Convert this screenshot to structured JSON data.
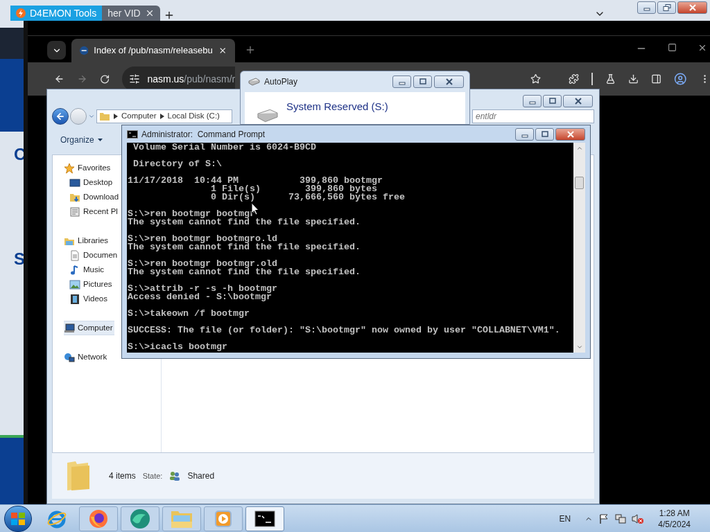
{
  "outer_browser": {
    "tabs": [
      {
        "title": "D4EMON Tools",
        "selected": true
      },
      {
        "title": "her VID",
        "selected": false
      }
    ],
    "page_fragments": [
      "C",
      "S"
    ]
  },
  "browser": {
    "tabs": [
      {
        "title": "Index of /pub/nasm/releasebu",
        "selected": true
      }
    ],
    "address": {
      "host": "nasm.us",
      "path": "/pub/nasm/r"
    }
  },
  "explorer": {
    "breadcrumb": [
      "Computer",
      "Local Disk (C:)"
    ],
    "search_placeholder": "entldr",
    "toolbar": [
      "Organize"
    ],
    "nav": [
      {
        "label": "Favorites",
        "kind": "favorites",
        "selected": false,
        "children": [
          {
            "label": "Desktop",
            "kind": "desktop",
            "selected": false
          },
          {
            "label": "Download",
            "kind": "downloads",
            "selected": false
          },
          {
            "label": "Recent Pl",
            "kind": "recent",
            "selected": false
          }
        ]
      },
      {
        "label": "Libraries",
        "kind": "libraries",
        "selected": false,
        "children": [
          {
            "label": "Documen",
            "kind": "documents",
            "selected": false
          },
          {
            "label": "Music",
            "kind": "music",
            "selected": false
          },
          {
            "label": "Pictures",
            "kind": "pictures",
            "selected": false
          },
          {
            "label": "Videos",
            "kind": "videos",
            "selected": false
          }
        ]
      },
      {
        "label": "Computer",
        "kind": "computer",
        "selected": true
      },
      {
        "label": "Network",
        "kind": "network",
        "selected": false
      }
    ],
    "details": {
      "count": "4 items",
      "state_label": "State:",
      "state": "Shared"
    }
  },
  "autoplay": {
    "title": "AutoPlay",
    "drive": "System Reserved (S:)"
  },
  "cmd": {
    "title": "Administrator:  Command Prompt",
    "blocks": [
      [
        " Volume Serial Number is 6024-B9CD"
      ],
      [
        " Directory of S:\\"
      ],
      [
        "11/17/2018  10:44 PM           399,860 bootmgr",
        "               1 File(s)        399,860 bytes",
        "               0 Dir(s)      73,666,560 bytes free"
      ],
      [
        "S:\\>ren bootmgr bootmgr",
        "The system cannot find the file specified."
      ],
      [
        "S:\\>ren bootmgr bootmgro.ld",
        "The system cannot find the file specified."
      ],
      [
        "S:\\>ren bootmgr bootmgr.old",
        "The system cannot find the file specified."
      ],
      [
        "S:\\>attrib -r -s -h bootmgr",
        "Access denied - S:\\bootmgr"
      ],
      [
        "S:\\>takeown /f bootmgr"
      ],
      [
        "SUCCESS: The file (or folder): \"S:\\bootmgr\" now owned by user \"COLLABNET\\VM1\"."
      ],
      [
        "S:\\>icacls bootmgr"
      ]
    ]
  },
  "taskbar": {
    "apps": [
      {
        "kind": "ie",
        "selected": false
      },
      {
        "kind": "firefox",
        "selected": false
      },
      {
        "kind": "edge",
        "selected": false
      },
      {
        "kind": "explorer",
        "selected": false
      },
      {
        "kind": "media",
        "selected": false
      },
      {
        "kind": "cmd",
        "selected": true
      }
    ],
    "language": "EN",
    "muted": true,
    "time": "1:28 AM",
    "date": "4/5/2024"
  }
}
